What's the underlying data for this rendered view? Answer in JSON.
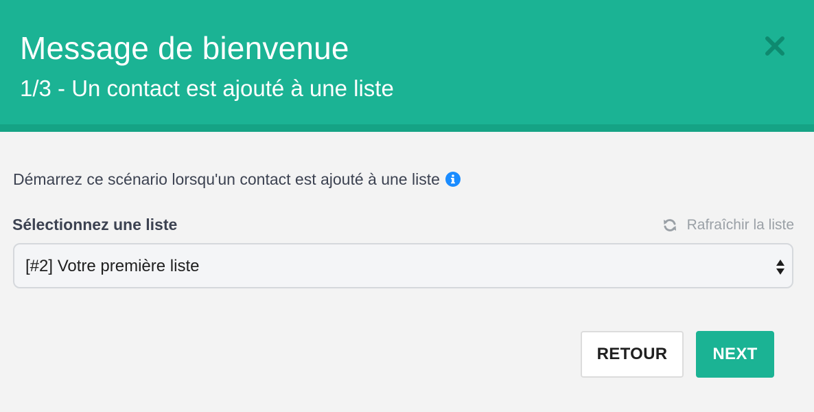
{
  "modal": {
    "title": "Message de bienvenue",
    "subtitle": "1/3 - Un contact est ajouté à une liste",
    "close_icon": "close-icon"
  },
  "body": {
    "description": "Démarrez ce scénario lorsqu'un contact est ajouté à une liste",
    "info_icon": "info-circle-icon",
    "select_label": "Sélectionnez une liste",
    "refresh_label": "Rafraîchir la liste",
    "refresh_icon": "refresh-icon",
    "select": {
      "selected_value": "[#2] Votre première liste"
    }
  },
  "footer": {
    "back_label": "RETOUR",
    "next_label": "NEXT"
  },
  "colors": {
    "accent": "#1bb394",
    "accent_dark": "#15a385",
    "info_blue": "#1a8cff",
    "text_dark": "#3c4251",
    "text_muted": "#9aa0a6",
    "background": "#f3f3f3"
  }
}
